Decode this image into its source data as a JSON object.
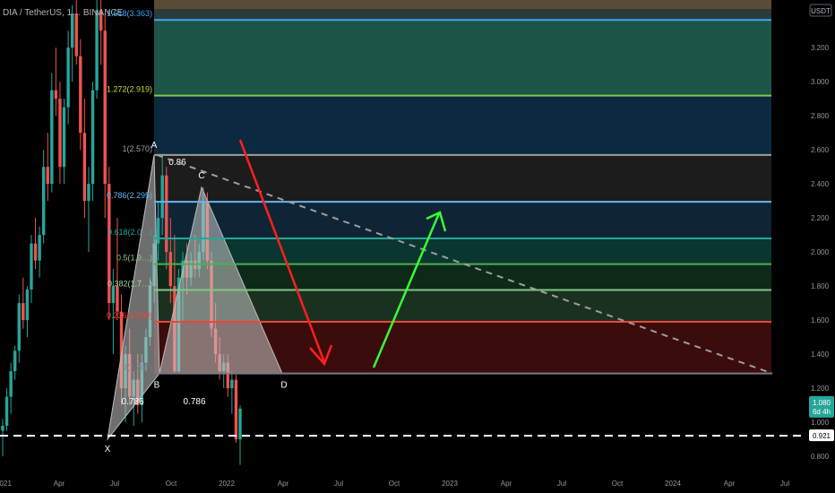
{
  "chart_data": {
    "type": "candlestick",
    "title": "DIA / TetherUS, 1… BINANCE",
    "y_axis_unit": "USDT",
    "ylim": [
      0.69,
      3.48
    ],
    "y_ticks": [
      "3.200",
      "3.000",
      "2.800",
      "2.600",
      "2.400",
      "2.200",
      "2.000",
      "1.800",
      "1.600",
      "1.400",
      "1.200",
      "1.000",
      "0.800"
    ],
    "x_ticks": [
      "2021",
      "Apr",
      "Jul",
      "Oct",
      "2022",
      "Apr",
      "Jul",
      "Oct",
      "2023",
      "Apr",
      "Jul",
      "Oct",
      "2024",
      "Apr",
      "Jul"
    ],
    "fib_levels": [
      {
        "ratio_label": "1.618(3.363)",
        "value": 3.363,
        "color": "#42a5f5",
        "label_color": "#42a5f5"
      },
      {
        "ratio_label": "1.272(2.919)",
        "value": 2.919,
        "color": "#8bc34a",
        "label_color": "#cddc39"
      },
      {
        "ratio_label": "1(2.570)",
        "value": 2.57,
        "color": "#9e9e9e",
        "label_color": "#9e9e9e"
      },
      {
        "ratio_label": "0.786(2.295)",
        "value": 2.295,
        "color": "#64b5f6",
        "label_color": "#64b5f6"
      },
      {
        "ratio_label": "0.618(2.0…)",
        "value": 2.08,
        "color": "#26a69a",
        "label_color": "#26a69a"
      },
      {
        "ratio_label": "0.5(1.9…)",
        "value": 1.929,
        "color": "#4caf50",
        "label_color": "#81c784"
      },
      {
        "ratio_label": "0.382(1.7…)",
        "value": 1.777,
        "color": "#81c784",
        "label_color": "#a5d6a7"
      },
      {
        "ratio_label": "0.236(1.590)",
        "value": 1.59,
        "color": "#f44336",
        "label_color": "#f44336"
      },
      {
        "ratio_label": "0(1.287)",
        "value": 1.287,
        "color": "#787b86",
        "label_color": "#787b86"
      }
    ],
    "fib_zone_colors": [
      "#2a3a3d",
      "#1d5448",
      "#0c2a3f",
      "#1c1c1c",
      "#0f2535",
      "#0a3630",
      "#0d2a18",
      "#1b3120",
      "#3a0c0c"
    ],
    "harmonic_points": [
      {
        "label": "X",
        "value": 0.9
      },
      {
        "label": "A",
        "value": 2.57
      },
      {
        "label": "B",
        "value": 1.287
      },
      {
        "label": "C",
        "value": 2.38
      },
      {
        "label": "D",
        "value": 1.287
      }
    ],
    "harmonic_ratios": [
      "0.86",
      "0.786",
      "0.786"
    ],
    "dashed_level": {
      "value": 0.921,
      "label": "0.921"
    },
    "current_price": {
      "value": 1.08,
      "label": "1.080",
      "countdown": "6d 4h"
    },
    "candles": [
      {
        "o": 0.95,
        "h": 1.02,
        "l": 0.8,
        "c": 0.98
      },
      {
        "o": 0.98,
        "h": 1.2,
        "l": 0.95,
        "c": 1.15
      },
      {
        "o": 1.15,
        "h": 1.35,
        "l": 1.05,
        "c": 1.3
      },
      {
        "o": 1.3,
        "h": 1.45,
        "l": 1.25,
        "c": 1.42
      },
      {
        "o": 1.42,
        "h": 1.75,
        "l": 1.35,
        "c": 1.7
      },
      {
        "o": 1.7,
        "h": 1.85,
        "l": 1.55,
        "c": 1.6
      },
      {
        "o": 1.6,
        "h": 1.8,
        "l": 1.5,
        "c": 1.78
      },
      {
        "o": 1.78,
        "h": 2.1,
        "l": 1.7,
        "c": 2.05
      },
      {
        "o": 2.05,
        "h": 2.2,
        "l": 1.9,
        "c": 1.95
      },
      {
        "o": 1.95,
        "h": 2.15,
        "l": 1.85,
        "c": 2.1
      },
      {
        "o": 2.1,
        "h": 2.6,
        "l": 2.05,
        "c": 2.5
      },
      {
        "o": 2.5,
        "h": 2.7,
        "l": 2.3,
        "c": 2.4
      },
      {
        "o": 2.4,
        "h": 3.05,
        "l": 2.35,
        "c": 2.95
      },
      {
        "o": 2.95,
        "h": 3.2,
        "l": 2.8,
        "c": 2.9
      },
      {
        "o": 2.9,
        "h": 3.0,
        "l": 2.4,
        "c": 2.5
      },
      {
        "o": 2.5,
        "h": 2.9,
        "l": 2.4,
        "c": 2.85
      },
      {
        "o": 2.85,
        "h": 3.3,
        "l": 2.75,
        "c": 3.2
      },
      {
        "o": 3.2,
        "h": 3.45,
        "l": 3.0,
        "c": 3.4
      },
      {
        "o": 3.4,
        "h": 3.48,
        "l": 3.1,
        "c": 3.15
      },
      {
        "o": 3.15,
        "h": 3.25,
        "l": 2.6,
        "c": 2.7
      },
      {
        "o": 2.7,
        "h": 2.9,
        "l": 2.2,
        "c": 2.3
      },
      {
        "o": 2.3,
        "h": 2.5,
        "l": 2.0,
        "c": 2.4
      },
      {
        "o": 2.4,
        "h": 3.0,
        "l": 2.3,
        "c": 2.95
      },
      {
        "o": 2.95,
        "h": 3.48,
        "l": 2.9,
        "c": 3.42
      },
      {
        "o": 3.42,
        "h": 3.48,
        "l": 3.1,
        "c": 3.3
      },
      {
        "o": 3.3,
        "h": 3.4,
        "l": 2.2,
        "c": 2.4
      },
      {
        "o": 2.4,
        "h": 2.5,
        "l": 1.6,
        "c": 1.7
      },
      {
        "o": 1.7,
        "h": 1.9,
        "l": 1.4,
        "c": 1.8
      },
      {
        "o": 1.8,
        "h": 2.2,
        "l": 1.6,
        "c": 1.65
      },
      {
        "o": 1.65,
        "h": 1.75,
        "l": 1.1,
        "c": 1.2
      },
      {
        "o": 1.2,
        "h": 1.45,
        "l": 1.0,
        "c": 1.4
      },
      {
        "o": 1.4,
        "h": 1.55,
        "l": 1.1,
        "c": 1.15
      },
      {
        "o": 1.15,
        "h": 1.3,
        "l": 0.98,
        "c": 1.25
      },
      {
        "o": 1.25,
        "h": 1.4,
        "l": 1.05,
        "c": 1.1
      },
      {
        "o": 1.1,
        "h": 1.4,
        "l": 1.0,
        "c": 1.35
      },
      {
        "o": 1.35,
        "h": 1.55,
        "l": 1.3,
        "c": 1.5
      },
      {
        "o": 1.5,
        "h": 1.85,
        "l": 1.45,
        "c": 1.8
      },
      {
        "o": 1.8,
        "h": 2.1,
        "l": 1.7,
        "c": 2.05
      },
      {
        "o": 2.05,
        "h": 2.3,
        "l": 1.95,
        "c": 2.2
      },
      {
        "o": 2.2,
        "h": 2.57,
        "l": 2.1,
        "c": 2.45
      },
      {
        "o": 2.45,
        "h": 2.5,
        "l": 1.9,
        "c": 2.0
      },
      {
        "o": 2.0,
        "h": 2.2,
        "l": 1.7,
        "c": 1.8
      },
      {
        "o": 1.8,
        "h": 2.1,
        "l": 1.29,
        "c": 1.3
      },
      {
        "o": 1.3,
        "h": 1.9,
        "l": 1.29,
        "c": 1.85
      },
      {
        "o": 1.85,
        "h": 2.0,
        "l": 1.6,
        "c": 1.95
      },
      {
        "o": 1.95,
        "h": 2.05,
        "l": 1.75,
        "c": 1.85
      },
      {
        "o": 1.85,
        "h": 2.0,
        "l": 1.8,
        "c": 1.95
      },
      {
        "o": 1.95,
        "h": 2.1,
        "l": 1.85,
        "c": 1.9
      },
      {
        "o": 1.9,
        "h": 2.05,
        "l": 1.85,
        "c": 2.0
      },
      {
        "o": 2.0,
        "h": 2.38,
        "l": 1.95,
        "c": 2.3
      },
      {
        "o": 2.3,
        "h": 2.35,
        "l": 1.9,
        "c": 1.95
      },
      {
        "o": 1.95,
        "h": 2.0,
        "l": 1.5,
        "c": 1.55
      },
      {
        "o": 1.55,
        "h": 1.7,
        "l": 1.35,
        "c": 1.4
      },
      {
        "o": 1.4,
        "h": 1.5,
        "l": 1.25,
        "c": 1.3
      },
      {
        "o": 1.3,
        "h": 1.4,
        "l": 1.2,
        "c": 1.35
      },
      {
        "o": 1.35,
        "h": 1.4,
        "l": 1.15,
        "c": 1.2
      },
      {
        "o": 1.2,
        "h": 1.3,
        "l": 1.05,
        "c": 1.25
      },
      {
        "o": 1.25,
        "h": 1.28,
        "l": 0.88,
        "c": 0.9
      },
      {
        "o": 0.9,
        "h": 1.1,
        "l": 0.75,
        "c": 1.08
      }
    ]
  },
  "tools": {
    "price_badge_icon": "tag-icon"
  }
}
